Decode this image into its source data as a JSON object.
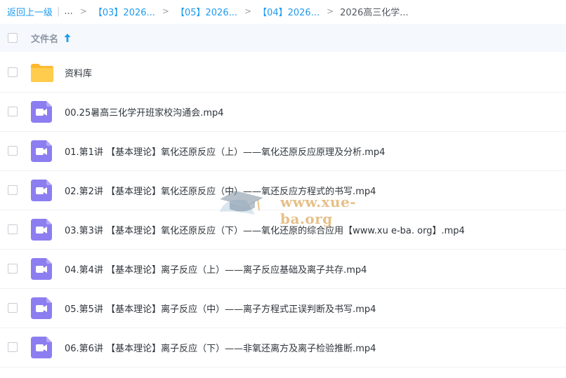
{
  "breadcrumb": {
    "back": "返回上一级",
    "sep": "|",
    "ellipsis": "...",
    "gt": ">",
    "items": [
      "【03】2026...",
      "【05】2026...",
      "【04】2026..."
    ],
    "current": "2026高三化学..."
  },
  "header": {
    "name_label": "文件名",
    "sort_icon": "arrow-up-icon"
  },
  "folder": {
    "name": "资料库",
    "icon": "folder-icon"
  },
  "files": [
    "00.25暑高三化学开班家校沟通会.mp4",
    "01.第1讲 【基本理论】氧化还原反应（上）——氧化还原反应原理及分析.mp4",
    "02.第2讲 【基本理论】氧化还原反应（中）——氧还反应方程式的书写.mp4",
    "03.第3讲 【基本理论】氧化还原反应（下）——氧化还原的综合应用【www.xu e-ba. org】.mp4",
    "04.第4讲 【基本理论】离子反应（上）——离子反应基础及离子共存.mp4",
    "05.第5讲 【基本理论】离子反应（中）——离子方程式正误判断及书写.mp4",
    "06.第6讲 【基本理论】离子反应（下）——非氧还离方及离子检验推断.mp4"
  ],
  "video_icon": "video-file-icon",
  "watermark": {
    "text": "www.xue-ba.org"
  },
  "colors": {
    "link": "#1e9bf0",
    "video_icon": "#8c7ef0",
    "folder": "#ffc94d"
  }
}
